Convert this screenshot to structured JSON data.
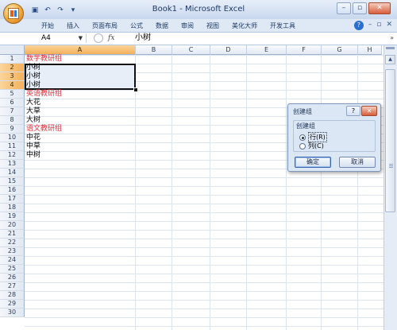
{
  "window": {
    "title": "Book1 - Microsoft Excel",
    "controls": [
      "–",
      "▫",
      "✕"
    ]
  },
  "quick_access": [
    "save-icon",
    "undo-icon",
    "redo-icon",
    "customize-icon"
  ],
  "ribbon": {
    "tabs": [
      "开始",
      "插入",
      "页面布局",
      "公式",
      "数据",
      "审阅",
      "视图",
      "美化大师",
      "开发工具"
    ],
    "right": [
      "?",
      "–",
      "▫",
      "✕"
    ]
  },
  "formula_bar": {
    "name_box": "A4",
    "fx": "fx",
    "value": "小树"
  },
  "sheet": {
    "columns": [
      "A",
      "B",
      "C",
      "D",
      "E",
      "F",
      "G",
      "H"
    ],
    "selected_column": "A",
    "rows": [
      "1",
      "2",
      "3",
      "4",
      "5",
      "6",
      "7",
      "8",
      "9",
      "10",
      "11",
      "12",
      "13",
      "14",
      "15",
      "16",
      "17",
      "18",
      "19",
      "20",
      "21",
      "22",
      "23",
      "24",
      "25",
      "26",
      "27",
      "28",
      "29",
      "30"
    ],
    "selected_rows": [
      "2",
      "3",
      "4"
    ],
    "cells": [
      {
        "row": 1,
        "text": "数学教研组",
        "color": "#e0303a"
      },
      {
        "row": 2,
        "text": "小树",
        "color": "#000000"
      },
      {
        "row": 3,
        "text": "小树",
        "color": "#000000"
      },
      {
        "row": 4,
        "text": "小树",
        "color": "#000000"
      },
      {
        "row": 5,
        "text": "英语教研组",
        "color": "#e0303a"
      },
      {
        "row": 6,
        "text": "大花",
        "color": "#000000"
      },
      {
        "row": 7,
        "text": "大草",
        "color": "#000000"
      },
      {
        "row": 8,
        "text": "大树",
        "color": "#000000"
      },
      {
        "row": 9,
        "text": "语文教研组",
        "color": "#e0303a"
      },
      {
        "row": 10,
        "text": "中花",
        "color": "#000000"
      },
      {
        "row": 11,
        "text": "中草",
        "color": "#000000"
      },
      {
        "row": 12,
        "text": "中树",
        "color": "#000000"
      }
    ]
  },
  "dialog": {
    "title": "创建组",
    "help": "?",
    "close": "✕",
    "group_label": "创建组",
    "options": [
      {
        "label": "行(R)",
        "selected": true
      },
      {
        "label": "列(C)",
        "selected": false
      }
    ],
    "ok": "确定",
    "cancel": "取消"
  }
}
